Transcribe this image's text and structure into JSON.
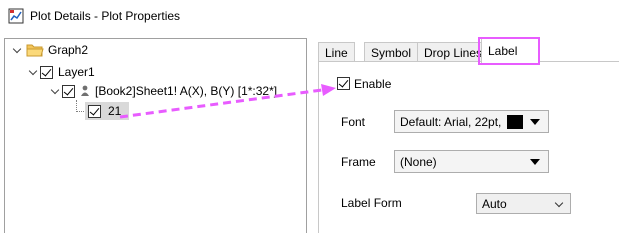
{
  "window": {
    "title": "Plot Details - Plot Properties"
  },
  "tree": {
    "graph": "Graph2",
    "layer": "Layer1",
    "plot": "[Book2]Sheet1! A(X), B(Y) [1*:32*]",
    "item": "21"
  },
  "tabs": [
    "Line",
    "Symbol",
    "Drop Lines",
    "Label"
  ],
  "active_tab": "Label",
  "label_props": {
    "enable_label": "Enable",
    "enable_checked": true,
    "font_label": "Font",
    "font_value": "Default: Arial, 22pt,",
    "font_color": "#000000",
    "frame_label": "Frame",
    "frame_value": "(None)",
    "label_form_label": "Label Form",
    "label_form_value": "Auto"
  },
  "accent": {
    "highlight": "#e85cff",
    "annotation_arrow": "#e85cff"
  },
  "icons": {
    "app": "plot-details-app-icon",
    "folder": "folder-icon",
    "plot": "person-icon"
  }
}
